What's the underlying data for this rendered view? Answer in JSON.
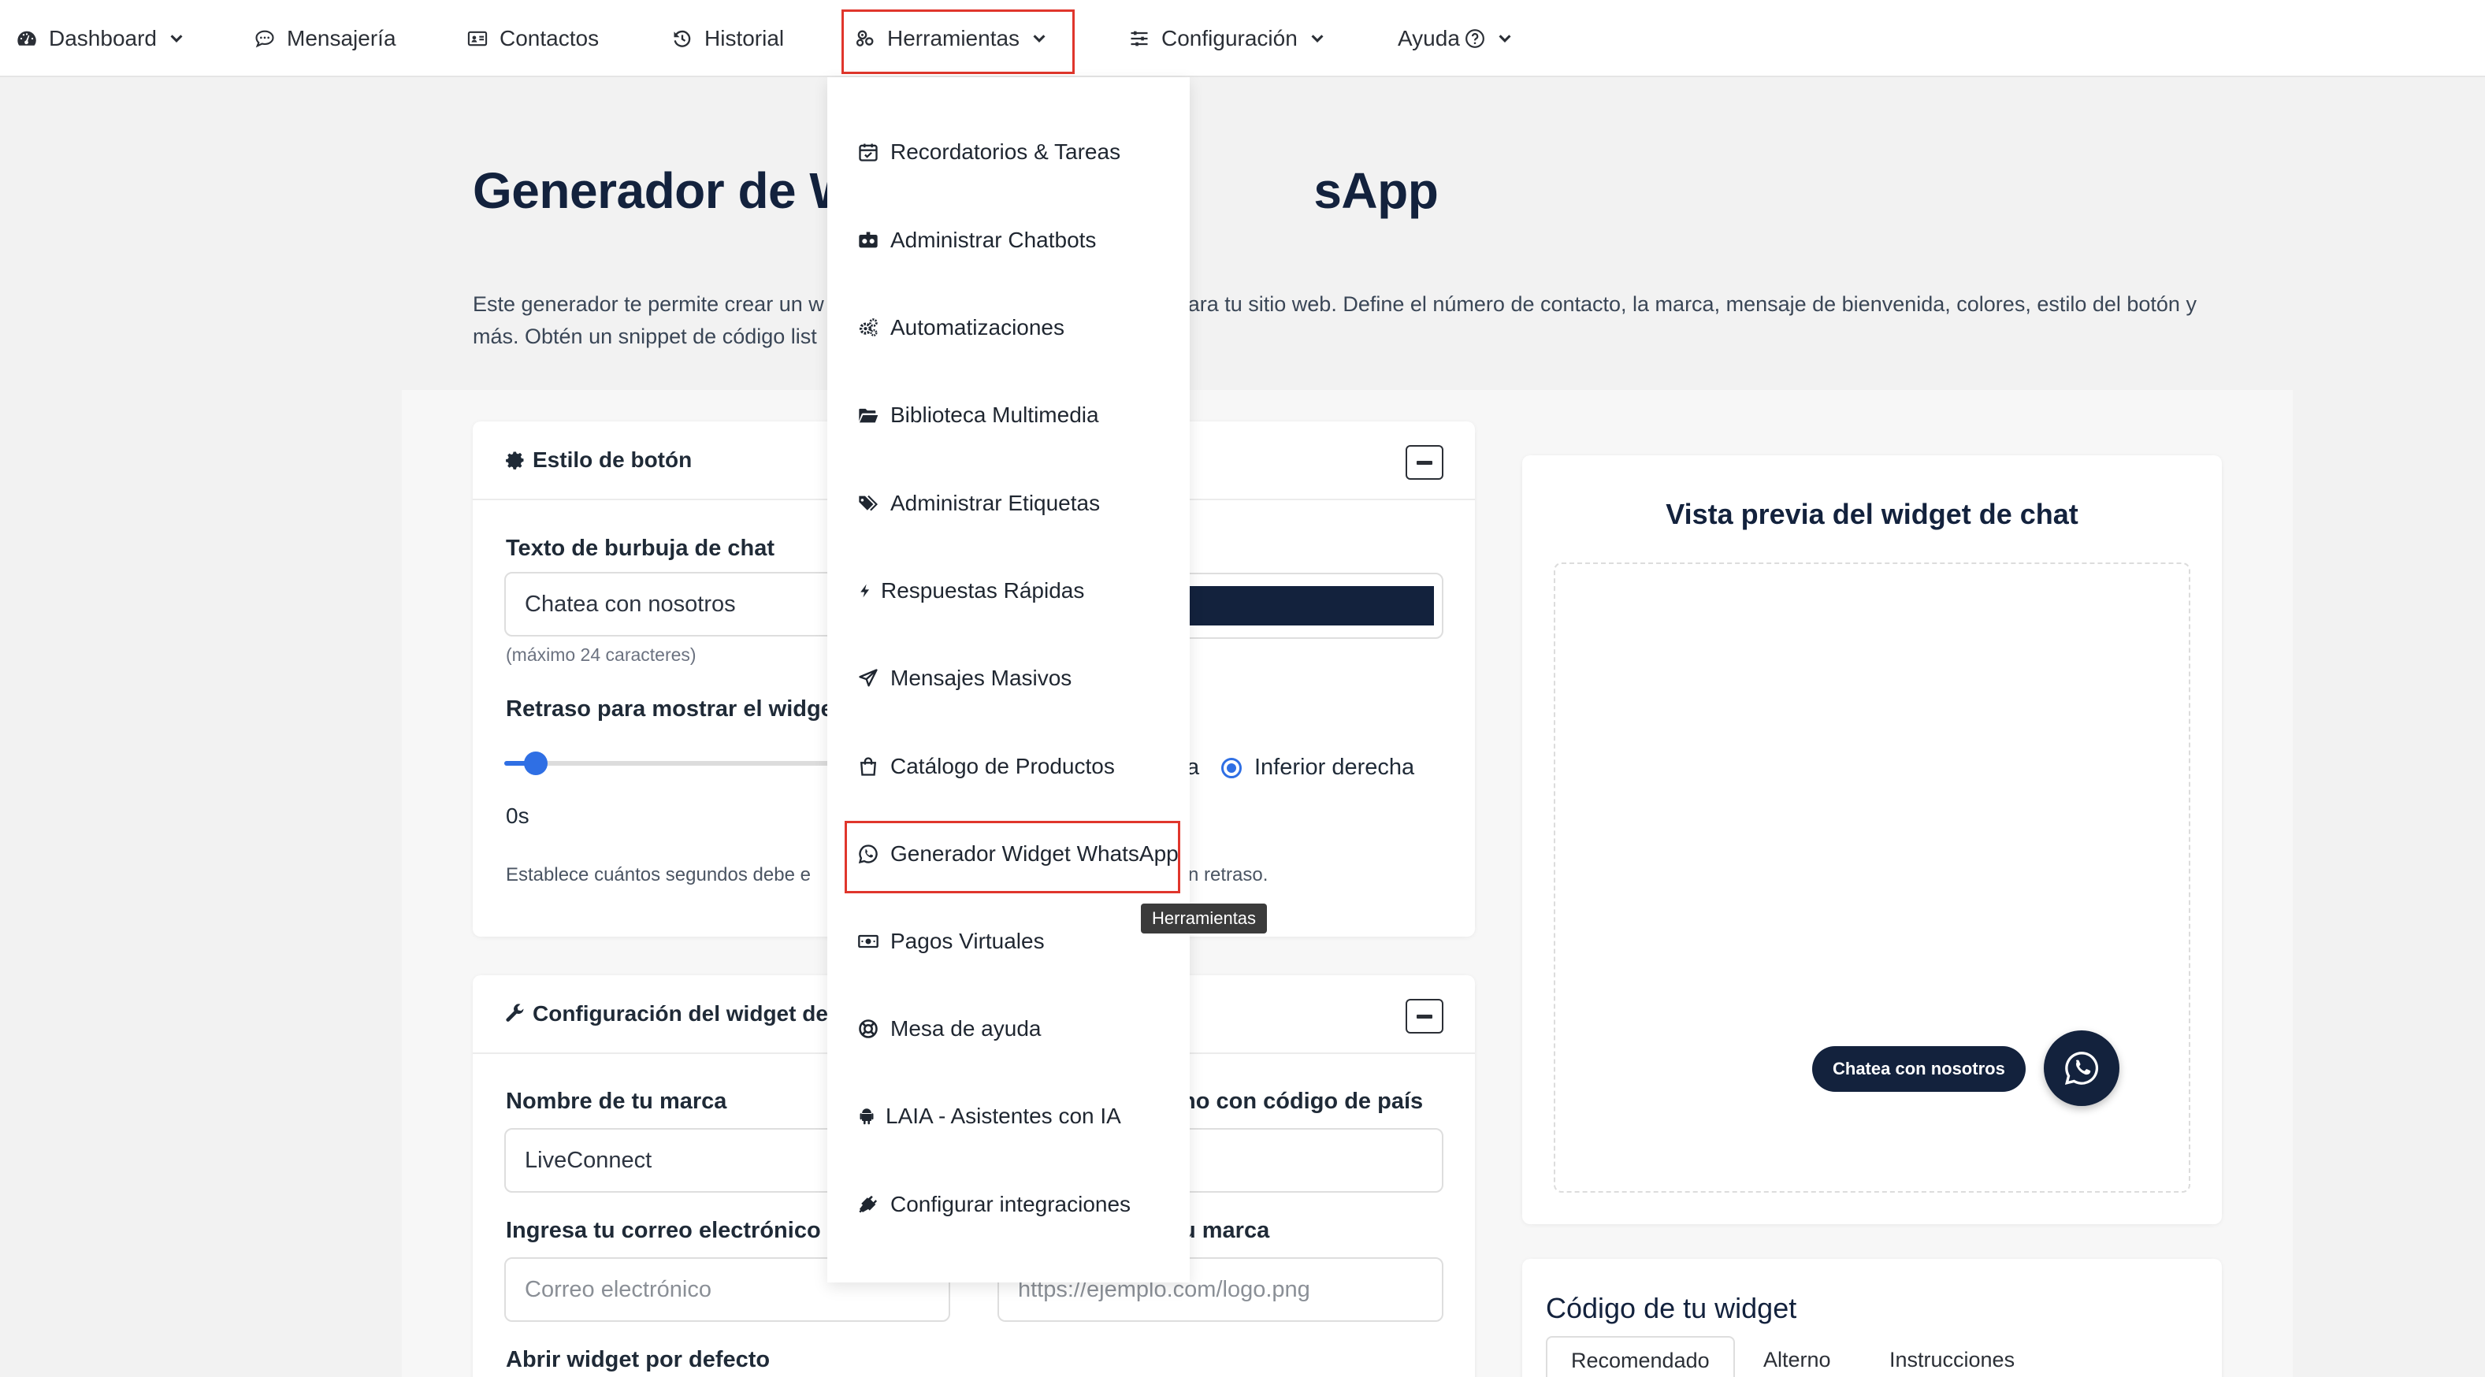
{
  "navbar": {
    "items": [
      {
        "label": "Dashboard",
        "icon": "gauge-icon"
      },
      {
        "label": "Mensajería",
        "icon": "chat-icon"
      },
      {
        "label": "Contactos",
        "icon": "address-card-icon"
      },
      {
        "label": "Historial",
        "icon": "history-icon"
      },
      {
        "label": "Herramientas",
        "icon": "tools-icon"
      },
      {
        "label": "Configuración",
        "icon": "sliders-icon"
      },
      {
        "label": "Ayuda",
        "icon": "help-icon"
      }
    ]
  },
  "page": {
    "title_start": "Generador de W",
    "title_end": "sApp",
    "desc_line1_start": "Este generador te permite crear un w",
    "desc_line1_end": "ara tu sitio web. Define el número de contacto, la marca, mensaje de bienvenida, colores, estilo del botón y",
    "desc_line2_start": "más. Obtén un snippet de código list"
  },
  "button_style_card": {
    "title": "Estilo de botón",
    "bubble_text_label": "Texto de burbuja de chat",
    "bubble_text_value": "Chatea con nosotros",
    "bubble_text_hint": "(máximo 24 caracteres)",
    "delay_label": "Retraso para mostrar el widge",
    "delay_value": "0s",
    "delay_value_num": 0,
    "delay_help_start": "Establece cuántos segundos debe e",
    "delay_help_end": "n retraso.",
    "position_left_fragment": "a",
    "position_selected": "Inferior derecha",
    "color_value": "#13223d"
  },
  "widget_config_card": {
    "title": "Configuración del widget de",
    "brand_label": "Nombre de tu marca",
    "brand_value": "LiveConnect",
    "phone_label_fragment": "no con código de país",
    "email_label": "Ingresa tu correo electrónico",
    "email_placeholder": "Correo electrónico",
    "logo_label_fragment": "u marca",
    "logo_placeholder": "https://ejemplo.com/logo.png",
    "open_default_label": "Abrir widget por defecto"
  },
  "preview": {
    "title": "Vista previa del widget de chat",
    "bubble": "Chatea con nosotros"
  },
  "code_card": {
    "title": "Código de tu widget",
    "tabs": [
      "Recomendado",
      "Alterno",
      "Instrucciones"
    ]
  },
  "dropdown": {
    "items": [
      {
        "label": "Recordatorios & Tareas",
        "icon": "calendar-check-icon"
      },
      {
        "label": "Administrar Chatbots",
        "icon": "robot-icon"
      },
      {
        "label": "Automatizaciones",
        "icon": "cogs-icon"
      },
      {
        "label": "Biblioteca Multimedia",
        "icon": "folder-open-icon"
      },
      {
        "label": "Administrar Etiquetas",
        "icon": "tags-icon"
      },
      {
        "label": "Respuestas Rápidas",
        "icon": "bolt-icon"
      },
      {
        "label": "Mensajes Masivos",
        "icon": "paper-plane-icon"
      },
      {
        "label": "Catálogo de Productos",
        "icon": "shopping-bag-icon"
      },
      {
        "label": "Generador Widget WhatsApp",
        "icon": "whatsapp-icon"
      },
      {
        "label": "Pagos Virtuales",
        "icon": "money-bill-icon"
      },
      {
        "label": "Mesa de ayuda",
        "icon": "life-ring-icon"
      },
      {
        "label": "LAIA - Asistentes con IA",
        "icon": "android-icon"
      },
      {
        "label": "Configurar integraciones",
        "icon": "plug-icon"
      }
    ],
    "tooltip": "Herramientas"
  }
}
